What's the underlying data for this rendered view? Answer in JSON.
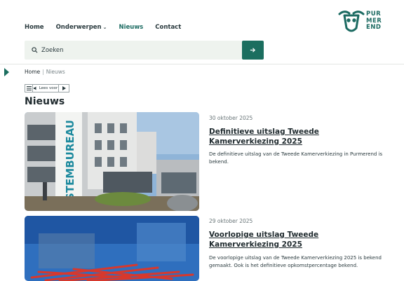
{
  "nav": {
    "items": [
      {
        "label": "Home"
      },
      {
        "label": "Onderwerpen"
      },
      {
        "label": "Nieuws"
      },
      {
        "label": "Contact"
      }
    ]
  },
  "logo": {
    "text": "PUR MER END",
    "color": "#1c6b62"
  },
  "search": {
    "placeholder": "Zoeken",
    "button_icon": "arrow-right-icon"
  },
  "breadcrumb": {
    "home": "Home",
    "separator": "|",
    "current": "Nieuws"
  },
  "readspeaker": {
    "menu_icon": "menu-icon",
    "label": "Lees voor",
    "play_icon": "play-icon"
  },
  "page": {
    "title": "Nieuws"
  },
  "news": [
    {
      "date": "30 oktober 2025",
      "title": "Definitieve uitslag Tweede Kamerverkiezing 2025",
      "description": "De definitieve uitslag van de Tweede Kamerverkiezing in Purmerend is bekend.",
      "image_text": "STEMBUREAU"
    },
    {
      "date": "29 oktober 2025",
      "title": "Voorlopige uitslag Tweede Kamerverkiezing 2025",
      "description": "De voorlopige uitslag van de Tweede Kamerverkiezing 2025 is bekend gemaakt. Ook is het definitieve opkomstpercentage bekend."
    }
  ],
  "colors": {
    "accent": "#1b6e5f",
    "search_bg": "#eef3ee"
  }
}
